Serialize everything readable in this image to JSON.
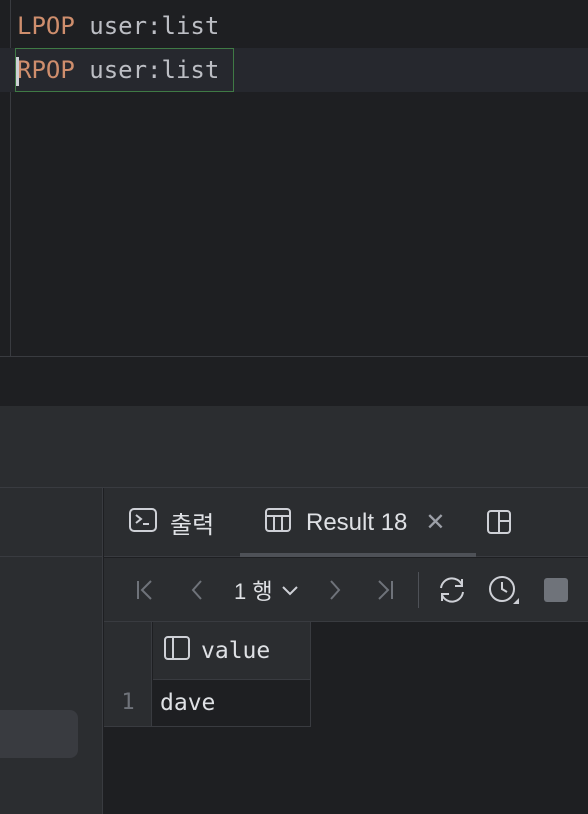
{
  "editor": {
    "lines": [
      {
        "keyword": "LPOP",
        "rest": " user:list"
      },
      {
        "keyword": "RPOP",
        "rest": " user:list"
      }
    ]
  },
  "results_panel": {
    "tabs": {
      "output_label": "출력",
      "result_label": "Result 18",
      "output_icon": "terminal-icon",
      "result_icon": "table-icon",
      "close_icon": "close-icon",
      "layout_icon": "layout-icon"
    },
    "toolbar": {
      "rows_label": "1 행",
      "icons": [
        "first-page-icon",
        "previous-page-icon",
        "chevron-down-icon",
        "next-page-icon",
        "last-page-icon",
        "refresh-icon",
        "history-icon",
        "stop-icon"
      ]
    },
    "grid": {
      "columns": [
        {
          "label": "value",
          "icon": "column-icon"
        }
      ],
      "rows": [
        {
          "num": "1",
          "value": "dave"
        }
      ]
    }
  },
  "colors": {
    "keyword": "#cf8e6d",
    "text": "#bcbec4",
    "background": "#1e1f22",
    "panel": "#2b2d30",
    "selection_border": "#3f7a45"
  }
}
